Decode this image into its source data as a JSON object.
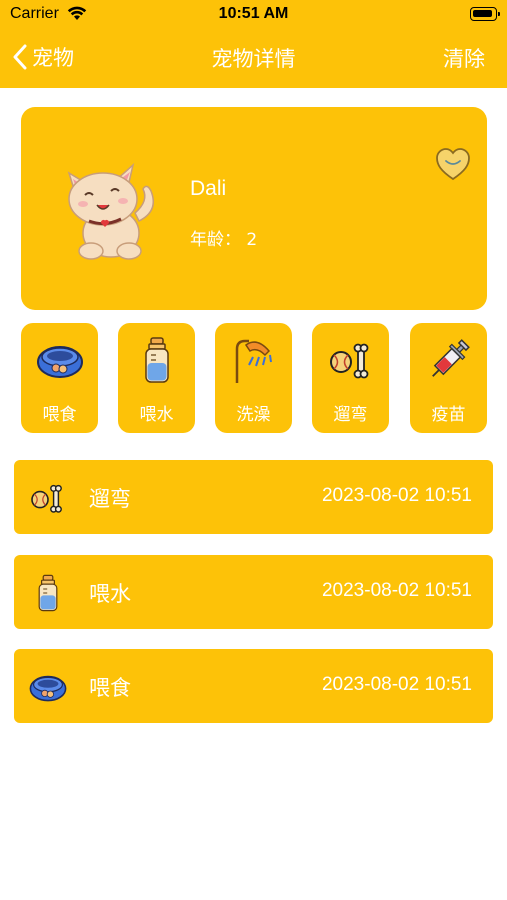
{
  "status_bar": {
    "carrier": "Carrier",
    "time": "10:51 AM"
  },
  "nav": {
    "back_label": "宠物",
    "title": "宠物详情",
    "clear_label": "清除"
  },
  "pet": {
    "name": "Dali",
    "age_text": "年龄：  2"
  },
  "actions": [
    {
      "label": "喂食",
      "icon": "food-bowl-icon"
    },
    {
      "label": "喂水",
      "icon": "water-bottle-icon"
    },
    {
      "label": "洗澡",
      "icon": "shower-icon"
    },
    {
      "label": "遛弯",
      "icon": "ball-bone-icon"
    },
    {
      "label": "疫苗",
      "icon": "syringe-icon"
    }
  ],
  "records": [
    {
      "name": "遛弯",
      "time": "2023-08-02 10:51",
      "icon": "ball-bone-icon"
    },
    {
      "name": "喂水",
      "time": "2023-08-02 10:51",
      "icon": "water-bottle-icon"
    },
    {
      "name": "喂食",
      "time": "2023-08-02 10:51",
      "icon": "food-bowl-icon"
    }
  ],
  "colors": {
    "accent": "#FDC208",
    "text_on_accent": "#FFFFFF"
  }
}
